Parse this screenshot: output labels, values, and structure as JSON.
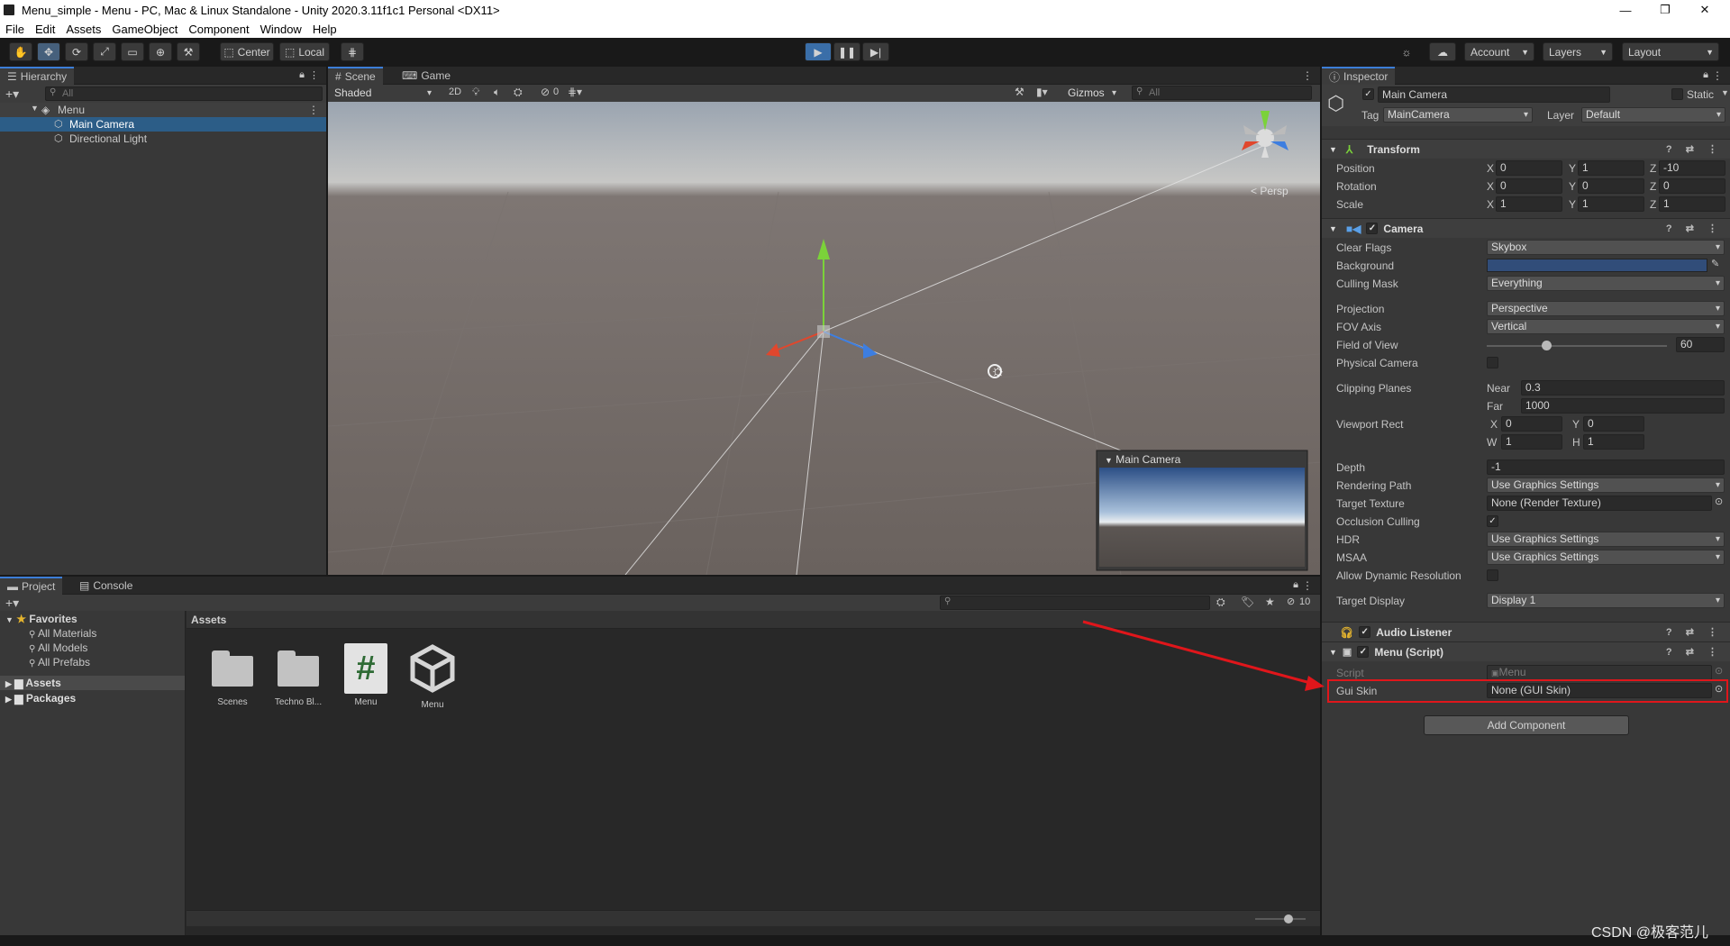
{
  "window": {
    "title": "Menu_simple - Menu - PC, Mac & Linux Standalone - Unity 2020.3.11f1c1 Personal <DX11>"
  },
  "menu": [
    "File",
    "Edit",
    "Assets",
    "GameObject",
    "Component",
    "Window",
    "Help"
  ],
  "toolbar": {
    "center_label": "Center",
    "local_label": "Local",
    "account_label": "Account",
    "layers_label": "Layers",
    "layout_label": "Layout"
  },
  "hierarchy": {
    "tab": "Hierarchy",
    "search_placeholder": "All",
    "scene": "Menu",
    "items": [
      "Main Camera",
      "Directional Light"
    ]
  },
  "scene_view": {
    "tab_scene": "Scene",
    "tab_game": "Game",
    "shading": "Shaded",
    "mode_2d": "2D",
    "hidden_count": "0",
    "gizmos": "Gizmos",
    "search_placeholder": "All",
    "persp": "Persp",
    "preview_title": "Main Camera"
  },
  "project": {
    "tab_project": "Project",
    "tab_console": "Console",
    "favorites": "Favorites",
    "fav_items": [
      "All Materials",
      "All Models",
      "All Prefabs"
    ],
    "assets_root": "Assets",
    "packages": "Packages",
    "breadcrumb": "Assets",
    "hidden_count": "10",
    "files": [
      {
        "name": "Scenes",
        "icon": "folder-icon"
      },
      {
        "name": "Techno Bl...",
        "icon": "folder-icon"
      },
      {
        "name": "Menu",
        "icon": "csharp-script-icon"
      },
      {
        "name": "Menu",
        "icon": "unity-scene-icon"
      }
    ]
  },
  "inspector": {
    "tab": "Inspector",
    "object_name": "Main Camera",
    "static_label": "Static",
    "tag_label": "Tag",
    "tag_value": "MainCamera",
    "layer_label": "Layer",
    "layer_value": "Default",
    "transform": {
      "title": "Transform",
      "position_label": "Position",
      "rotation_label": "Rotation",
      "scale_label": "Scale",
      "position": [
        "0",
        "1",
        "-10"
      ],
      "rotation": [
        "0",
        "0",
        "0"
      ],
      "scale": [
        "1",
        "1",
        "1"
      ]
    },
    "camera": {
      "title": "Camera",
      "clear_flags_label": "Clear Flags",
      "clear_flags": "Skybox",
      "background_label": "Background",
      "background_color": "#314d79",
      "culling_mask_label": "Culling Mask",
      "culling_mask": "Everything",
      "projection_label": "Projection",
      "projection": "Perspective",
      "fov_axis_label": "FOV Axis",
      "fov_axis": "Vertical",
      "fov_label": "Field of View",
      "fov": "60",
      "fov_slider_fraction": 0.33,
      "physical_camera_label": "Physical Camera",
      "clipping_label": "Clipping Planes",
      "near_label": "Near",
      "near": "0.3",
      "far_label": "Far",
      "far": "1000",
      "viewport_label": "Viewport Rect",
      "vx": "0",
      "vy": "0",
      "vw": "1",
      "vh": "1",
      "depth_label": "Depth",
      "depth": "-1",
      "rendering_path_label": "Rendering Path",
      "rendering_path": "Use Graphics Settings",
      "target_texture_label": "Target Texture",
      "target_texture": "None (Render Texture)",
      "occlusion_label": "Occlusion Culling",
      "hdr_label": "HDR",
      "hdr": "Use Graphics Settings",
      "msaa_label": "MSAA",
      "msaa": "Use Graphics Settings",
      "dynres_label": "Allow Dynamic Resolution",
      "target_display_label": "Target Display",
      "target_display": "Display 1"
    },
    "audio_listener": {
      "title": "Audio Listener"
    },
    "menu_script": {
      "title": "Menu (Script)",
      "script_label": "Script",
      "script_value": "Menu",
      "gui_skin_label": "Gui Skin",
      "gui_skin_value": "None (GUI Skin)"
    },
    "add_component": "Add Component"
  },
  "watermark": "CSDN @极客范儿"
}
